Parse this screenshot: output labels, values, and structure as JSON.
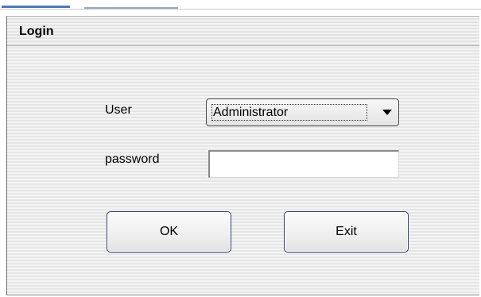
{
  "window": {
    "title": "Login"
  },
  "form": {
    "user_label": "User",
    "user_value": "Administrator",
    "password_label": "password",
    "password_value": ""
  },
  "buttons": {
    "ok_label": "OK",
    "exit_label": "Exit"
  },
  "icons": {
    "dropdown": "chevron-down-icon"
  }
}
